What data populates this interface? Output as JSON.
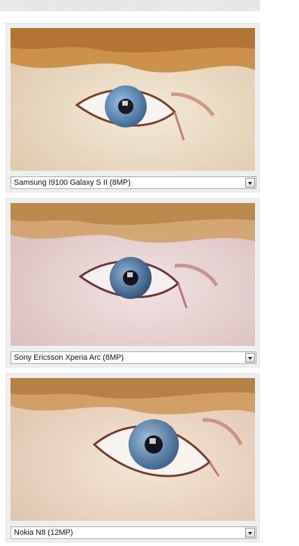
{
  "comparison": {
    "panels": [
      {
        "selected_option": "Samsung I9100 Galaxy S II (8MP)",
        "image": "close-up eye photo sample",
        "colors": {
          "skin": "#ecdcc4",
          "hair": "#c9893f",
          "iris": "#5f86ad"
        }
      },
      {
        "selected_option": "Sony Ericsson Xperia Arc (8MP)",
        "image": "close-up eye photo sample",
        "colors": {
          "skin": "#eacfd0",
          "hair": "#d2a26a",
          "iris": "#4f6f9a"
        }
      },
      {
        "selected_option": "Nokia N8 (12MP)",
        "image": "close-up eye photo sample",
        "colors": {
          "skin": "#f1d9c8",
          "hair": "#cf9a5f",
          "iris": "#6686a8"
        }
      }
    ]
  }
}
